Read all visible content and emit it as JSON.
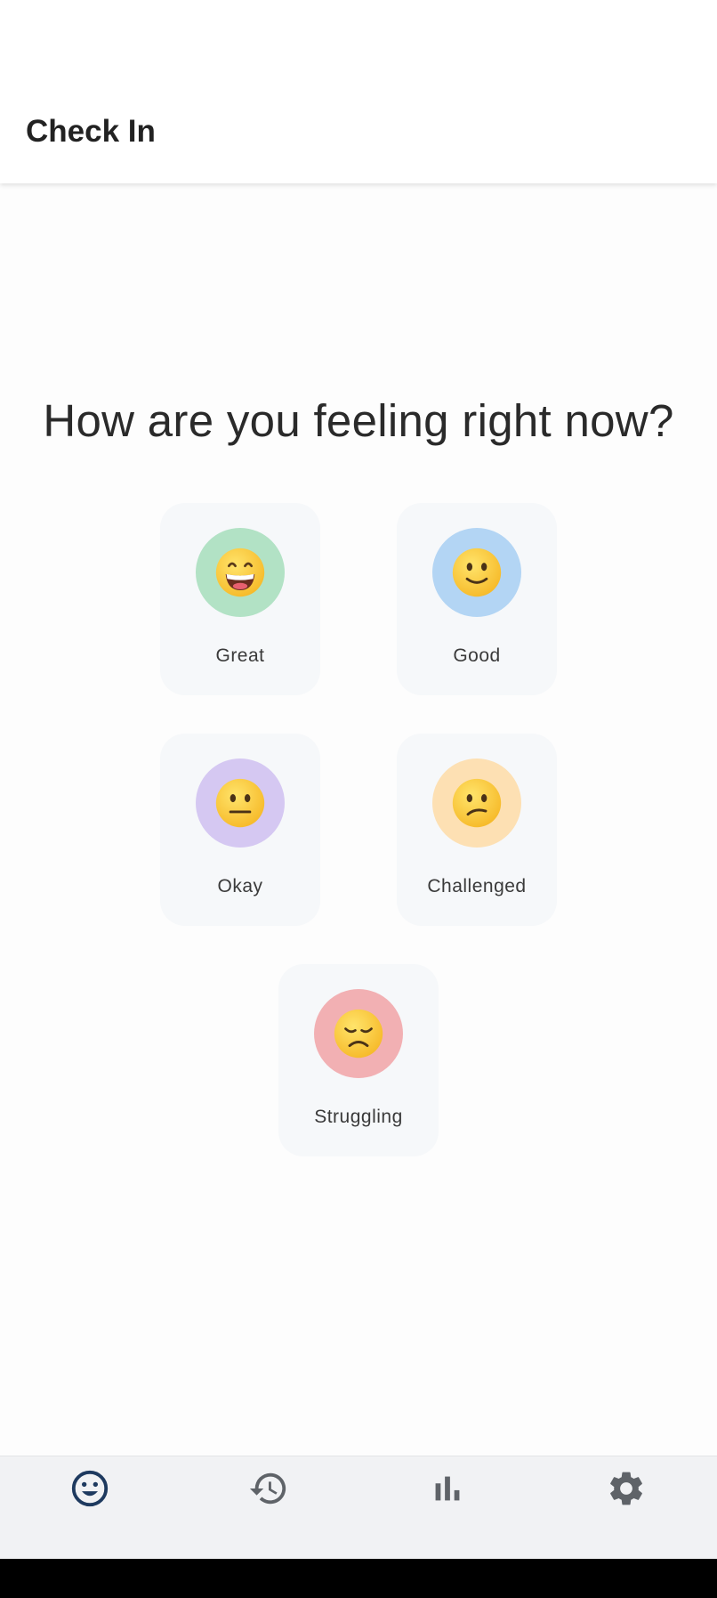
{
  "app_bar": {
    "title": "Check In"
  },
  "question": "How are you feeling right now?",
  "moods": [
    {
      "label": "Great",
      "icon": "grinning-face-icon",
      "color": "#b2e2c5"
    },
    {
      "label": "Good",
      "icon": "slightly-smiling-face-icon",
      "color": "#b3d5f4"
    },
    {
      "label": "Okay",
      "icon": "neutral-face-icon",
      "color": "#d5c8f2"
    },
    {
      "label": "Challenged",
      "icon": "confused-face-icon",
      "color": "#fde0b3"
    },
    {
      "label": "Struggling",
      "icon": "disappointed-face-icon",
      "color": "#f2b0b3"
    }
  ],
  "bottom_nav": {
    "items": [
      {
        "icon": "mood-icon",
        "active": true
      },
      {
        "icon": "history-icon",
        "active": false
      },
      {
        "icon": "bar-chart-icon",
        "active": false
      },
      {
        "icon": "settings-icon",
        "active": false
      }
    ],
    "active_color": "#1e3a5f",
    "inactive_color": "#5f6368"
  }
}
